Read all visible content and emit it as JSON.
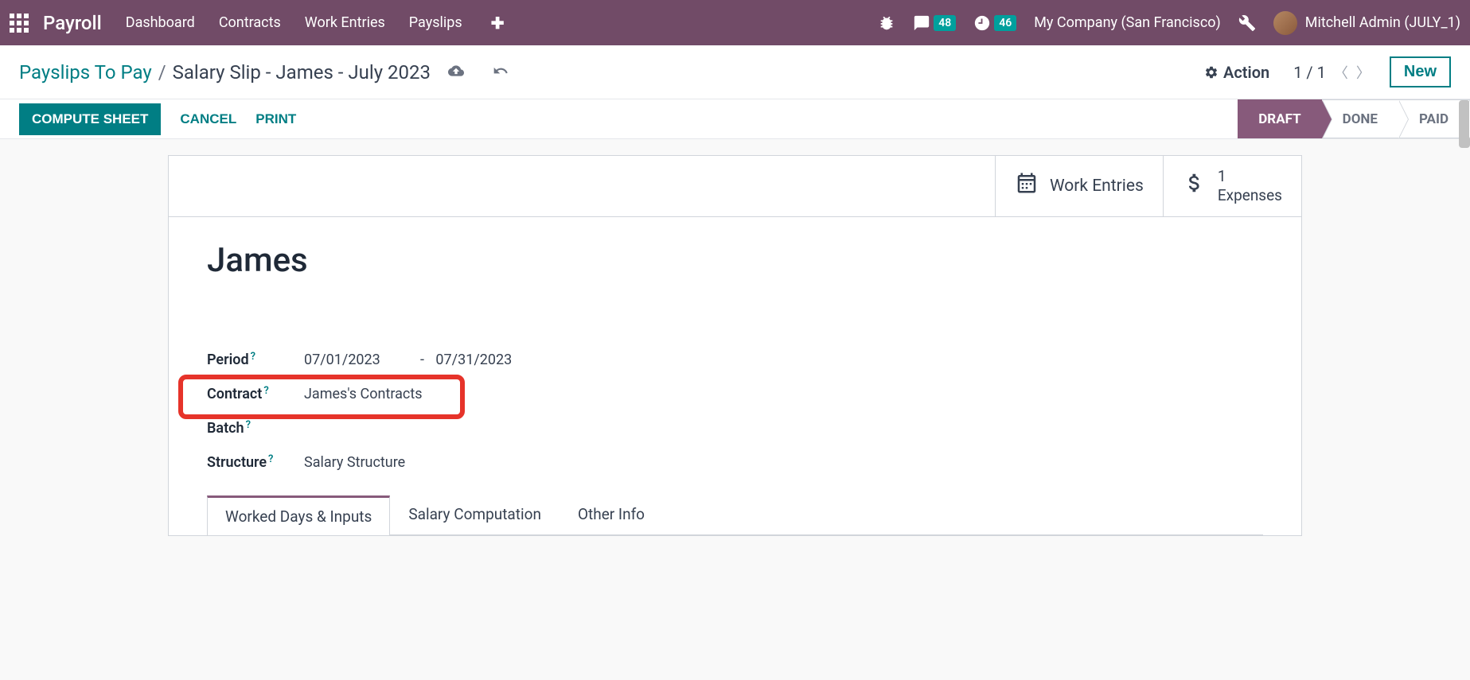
{
  "nav": {
    "app_title": "Payroll",
    "menu": [
      "Dashboard",
      "Contracts",
      "Work Entries",
      "Payslips"
    ],
    "messages_badge": "48",
    "activities_badge": "46",
    "company": "My Company (San Francisco)",
    "user": "Mitchell Admin (JULY_1)"
  },
  "breadcrumb": {
    "parent": "Payslips To Pay",
    "current": "Salary Slip - James - July 2023"
  },
  "controls": {
    "action_label": "Action",
    "pager": "1 / 1",
    "new_label": "New"
  },
  "buttons": {
    "compute": "COMPUTE SHEET",
    "cancel": "CANCEL",
    "print": "PRINT"
  },
  "status": {
    "draft": "DRAFT",
    "done": "DONE",
    "paid": "PAID"
  },
  "stat_buttons": {
    "work_entries": "Work Entries",
    "expenses_count": "1",
    "expenses_label": "Expenses"
  },
  "record": {
    "title": "James",
    "period_label": "Period",
    "period_from": "07/01/2023",
    "period_to": "07/31/2023",
    "contract_label": "Contract",
    "contract_value": "James's Contracts",
    "batch_label": "Batch",
    "batch_value": "",
    "structure_label": "Structure",
    "structure_value": "Salary Structure"
  },
  "tabs": {
    "worked_days": "Worked Days & Inputs",
    "salary_comp": "Salary Computation",
    "other_info": "Other Info"
  }
}
